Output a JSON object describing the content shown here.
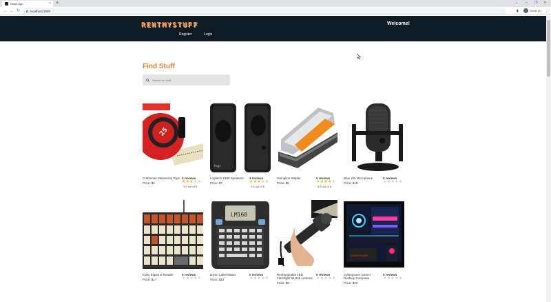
{
  "browser": {
    "tab_title": "React App",
    "tab_close": "×",
    "new_tab": "+",
    "url": "localhost:3000",
    "profile_name": "Guest (2)",
    "controls": {
      "minimize": "–",
      "restore": "❐",
      "close": "✕",
      "chevron": "⌄"
    },
    "nav": {
      "back": "←",
      "forward": "→",
      "reload": "↻"
    }
  },
  "header": {
    "logo": "RENTMYSTUFF",
    "nav": {
      "register": "Register",
      "login": "Login"
    },
    "welcome": "Welcome!"
  },
  "main": {
    "title": "Find Stuff",
    "search_placeholder": "Search for stuff"
  },
  "items": [
    {
      "name": "Craftsman Measuring Tape",
      "price": "Price: $2",
      "reviews": "4 reviews",
      "stars": 3,
      "rating": "3.0 out of 5",
      "image": "measuring-tape"
    },
    {
      "name": "Logitech Z150 Speakers",
      "price": "Price: $7",
      "reviews": "3 reviews",
      "stars": 2.5,
      "rating": "2.6 out of 5",
      "image": "speakers"
    },
    {
      "name": "Swingline Stapler",
      "price": "Price: $5",
      "reviews": "5 reviews",
      "stars": 4,
      "rating": "3.8 out of 5",
      "image": "stapler"
    },
    {
      "name": "Blue Yeti Microphone",
      "price": "Price: $18",
      "reviews": "0 reviews",
      "stars": 0,
      "rating": "",
      "image": "microphone"
    },
    {
      "name": "Kobo Elipsa E-Reader",
      "price": "Price: $17",
      "reviews": "0 reviews",
      "stars": 0,
      "rating": "",
      "image": "keyboard"
    },
    {
      "name": "Dymo Label Maker",
      "price": "Price: $12",
      "reviews": "0 reviews",
      "stars": 0,
      "rating": "",
      "image": "label-maker"
    },
    {
      "name": "Rechargeable LED Flashlight 90,000 Lumens",
      "price": "Price: $8",
      "reviews": "0 reviews",
      "stars": 0,
      "rating": "",
      "image": "flashlight"
    },
    {
      "name": "Cyberpower Gamer Desktop Computer",
      "price": "Price: $20",
      "reviews": "0 reviews",
      "stars": 0,
      "rating": "",
      "image": "gaming-pc"
    }
  ],
  "colors": {
    "header_bg": "#0e1a24",
    "accent": "#e0823a",
    "star_on": "#f6b500",
    "star_off": "#c8c8c8"
  }
}
